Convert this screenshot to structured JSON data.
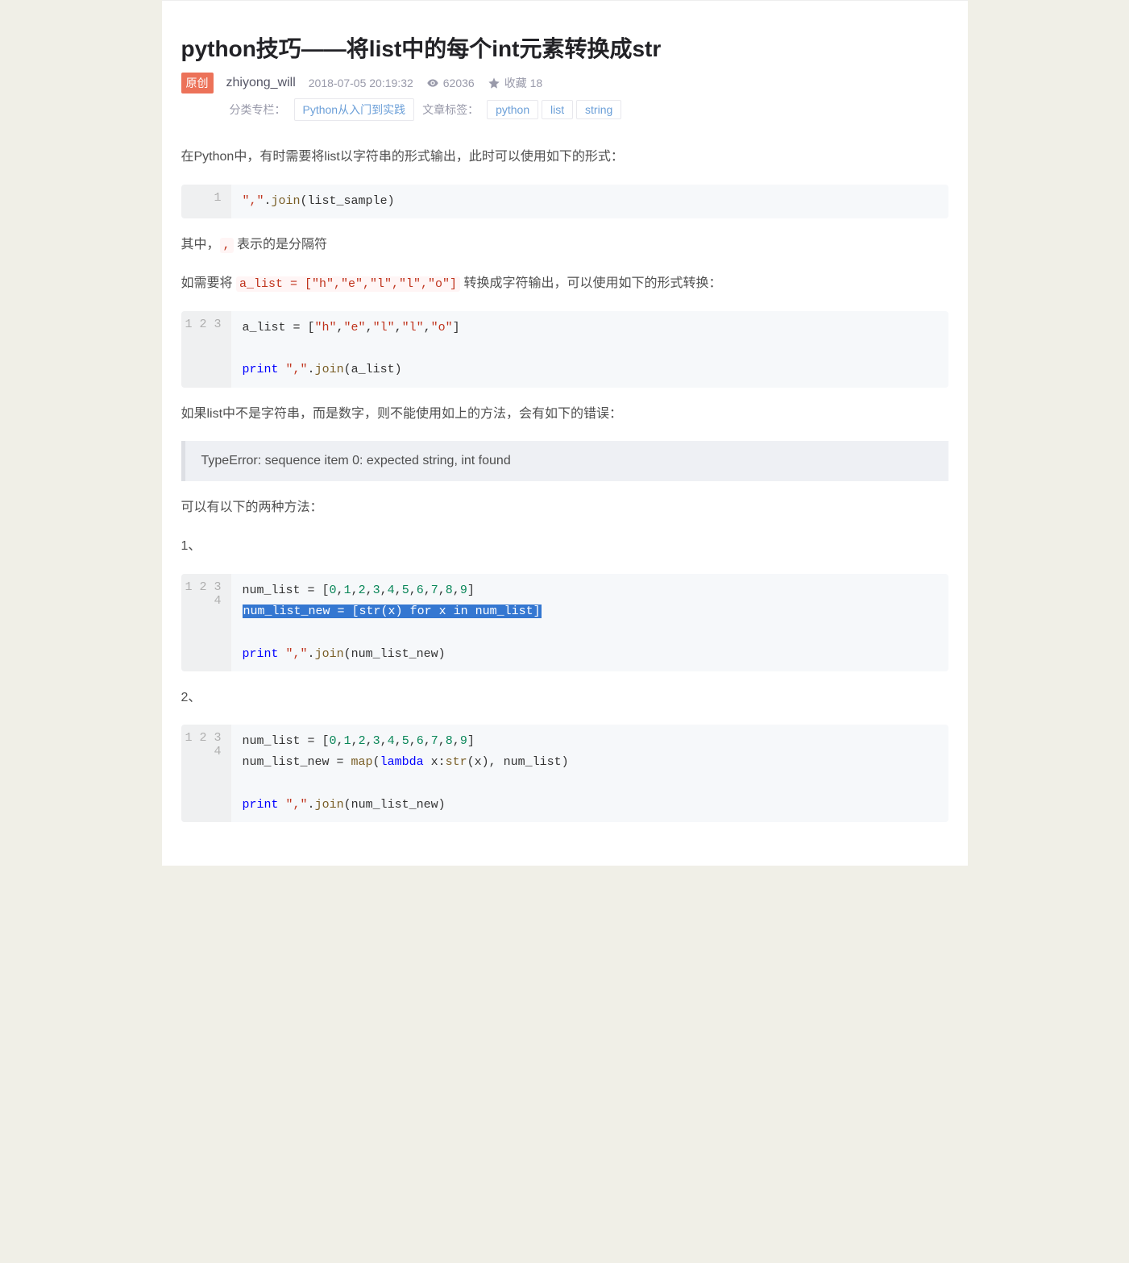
{
  "title": "python技巧——将list中的每个int元素转换成str",
  "badge_orig": "原创",
  "author": "zhiyong_will",
  "datetime": "2018-07-05 20:19:32",
  "views_label": "62036",
  "fav_label": "收藏 18",
  "category_label": "分类专栏：",
  "category_link": "Python从入门到实践",
  "tags_label": "文章标签：",
  "tags": [
    "python",
    "list",
    "string"
  ],
  "p1_a": "在Python中，有时需要将list以字符串的形式输出，此时可以使用如下的形式：",
  "p2_a": "其中，",
  "p2_code": ",",
  "p2_b": " 表示的是分隔符",
  "p3_a": "如需要将 ",
  "p3_code": "a_list = [\"h\",\"e\",\"l\",\"l\",\"o\"]",
  "p3_b": " 转换成字符输出，可以使用如下的形式转换：",
  "p4": "如果list中不是字符串，而是数字，则不能使用如上的方法，会有如下的错误：",
  "blockquote": "TypeError: sequence item 0: expected string, int found",
  "p5": "可以有以下的两种方法：",
  "p6": "1、",
  "p7": "2、",
  "code1": {
    "gutter": "1",
    "tokens": [
      {
        "t": "\",\"",
        "c": "tok-str"
      },
      {
        "t": ".",
        "c": "tok-punct"
      },
      {
        "t": "join",
        "c": "tok-fn"
      },
      {
        "t": "(list_sample)",
        "c": "tok-punct"
      }
    ]
  },
  "code2": {
    "gutter": "1\n2\n3",
    "lines": [
      [
        {
          "t": "a_list = [",
          "c": "tok-punct"
        },
        {
          "t": "\"h\"",
          "c": "tok-str"
        },
        {
          "t": ",",
          "c": "tok-punct"
        },
        {
          "t": "\"e\"",
          "c": "tok-str"
        },
        {
          "t": ",",
          "c": "tok-punct"
        },
        {
          "t": "\"l\"",
          "c": "tok-str"
        },
        {
          "t": ",",
          "c": "tok-punct"
        },
        {
          "t": "\"l\"",
          "c": "tok-str"
        },
        {
          "t": ",",
          "c": "tok-punct"
        },
        {
          "t": "\"o\"",
          "c": "tok-str"
        },
        {
          "t": "]",
          "c": "tok-punct"
        }
      ],
      [
        {
          "t": "",
          "c": ""
        }
      ],
      [
        {
          "t": "print",
          "c": "tok-kw"
        },
        {
          "t": " ",
          "c": ""
        },
        {
          "t": "\",\"",
          "c": "tok-str"
        },
        {
          "t": ".",
          "c": "tok-punct"
        },
        {
          "t": "join",
          "c": "tok-fn"
        },
        {
          "t": "(a_list)",
          "c": "tok-punct"
        }
      ]
    ]
  },
  "code3": {
    "gutter": "1\n2\n3\n4",
    "lines": [
      [
        {
          "t": "num_list = [",
          "c": "tok-punct"
        },
        {
          "t": "0",
          "c": "tok-num"
        },
        {
          "t": ",",
          "c": "tok-punct"
        },
        {
          "t": "1",
          "c": "tok-num"
        },
        {
          "t": ",",
          "c": "tok-punct"
        },
        {
          "t": "2",
          "c": "tok-num"
        },
        {
          "t": ",",
          "c": "tok-punct"
        },
        {
          "t": "3",
          "c": "tok-num"
        },
        {
          "t": ",",
          "c": "tok-punct"
        },
        {
          "t": "4",
          "c": "tok-num"
        },
        {
          "t": ",",
          "c": "tok-punct"
        },
        {
          "t": "5",
          "c": "tok-num"
        },
        {
          "t": ",",
          "c": "tok-punct"
        },
        {
          "t": "6",
          "c": "tok-num"
        },
        {
          "t": ",",
          "c": "tok-punct"
        },
        {
          "t": "7",
          "c": "tok-num"
        },
        {
          "t": ",",
          "c": "tok-punct"
        },
        {
          "t": "8",
          "c": "tok-num"
        },
        {
          "t": ",",
          "c": "tok-punct"
        },
        {
          "t": "9",
          "c": "tok-num"
        },
        {
          "t": "]",
          "c": "tok-punct"
        }
      ],
      [
        {
          "sel": true,
          "tokens": [
            {
              "t": "num_list_new = [",
              "c": "tok-punct"
            },
            {
              "t": "str",
              "c": "tok-fn"
            },
            {
              "t": "(x) ",
              "c": "tok-punct"
            },
            {
              "t": "for",
              "c": "tok-kw"
            },
            {
              "t": " x ",
              "c": "tok-punct"
            },
            {
              "t": "in",
              "c": "tok-kw"
            },
            {
              "t": " num_list]",
              "c": "tok-punct"
            }
          ]
        }
      ],
      [
        {
          "t": "",
          "c": ""
        }
      ],
      [
        {
          "t": "print",
          "c": "tok-kw"
        },
        {
          "t": " ",
          "c": ""
        },
        {
          "t": "\",\"",
          "c": "tok-str"
        },
        {
          "t": ".",
          "c": "tok-punct"
        },
        {
          "t": "join",
          "c": "tok-fn"
        },
        {
          "t": "(num_list_new)",
          "c": "tok-punct"
        }
      ]
    ]
  },
  "code4": {
    "gutter": "1\n2\n3\n4",
    "lines": [
      [
        {
          "t": "num_list = [",
          "c": "tok-punct"
        },
        {
          "t": "0",
          "c": "tok-num"
        },
        {
          "t": ",",
          "c": "tok-punct"
        },
        {
          "t": "1",
          "c": "tok-num"
        },
        {
          "t": ",",
          "c": "tok-punct"
        },
        {
          "t": "2",
          "c": "tok-num"
        },
        {
          "t": ",",
          "c": "tok-punct"
        },
        {
          "t": "3",
          "c": "tok-num"
        },
        {
          "t": ",",
          "c": "tok-punct"
        },
        {
          "t": "4",
          "c": "tok-num"
        },
        {
          "t": ",",
          "c": "tok-punct"
        },
        {
          "t": "5",
          "c": "tok-num"
        },
        {
          "t": ",",
          "c": "tok-punct"
        },
        {
          "t": "6",
          "c": "tok-num"
        },
        {
          "t": ",",
          "c": "tok-punct"
        },
        {
          "t": "7",
          "c": "tok-num"
        },
        {
          "t": ",",
          "c": "tok-punct"
        },
        {
          "t": "8",
          "c": "tok-num"
        },
        {
          "t": ",",
          "c": "tok-punct"
        },
        {
          "t": "9",
          "c": "tok-num"
        },
        {
          "t": "]",
          "c": "tok-punct"
        }
      ],
      [
        {
          "t": "num_list_new = ",
          "c": "tok-punct"
        },
        {
          "t": "map",
          "c": "tok-fn"
        },
        {
          "t": "(",
          "c": "tok-punct"
        },
        {
          "t": "lambda",
          "c": "tok-kw"
        },
        {
          "t": " x:",
          "c": "tok-punct"
        },
        {
          "t": "str",
          "c": "tok-fn"
        },
        {
          "t": "(x), num_list)",
          "c": "tok-punct"
        }
      ],
      [
        {
          "t": "",
          "c": ""
        }
      ],
      [
        {
          "t": "print",
          "c": "tok-kw"
        },
        {
          "t": " ",
          "c": ""
        },
        {
          "t": "\",\"",
          "c": "tok-str"
        },
        {
          "t": ".",
          "c": "tok-punct"
        },
        {
          "t": "join",
          "c": "tok-fn"
        },
        {
          "t": "(num_list_new)",
          "c": "tok-punct"
        }
      ]
    ]
  }
}
